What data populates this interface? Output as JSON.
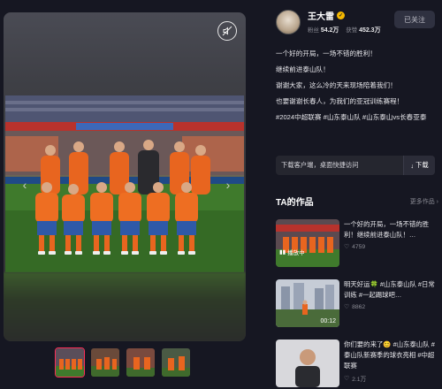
{
  "profile": {
    "name": "王大雷",
    "followers_label": "粉丝",
    "followers": "54.2万",
    "likes_label": "获赞",
    "likes": "452.3万",
    "follow_label": "已关注"
  },
  "post": {
    "lines": [
      "一个好的开局，一场不错的胜利！",
      "继续前进泰山队！",
      "谢谢大家，这么冷的天来现场陪着我们！",
      "也要谢谢长春人，为我们的亚冠训练赛程！",
      "#2024中超联赛 #山东泰山队 #山东泰山vs长春亚泰"
    ]
  },
  "download": {
    "text": "下载客户端，桌面快捷访问",
    "button": "下载"
  },
  "works": {
    "title": "TA的作品",
    "more": "更多作品",
    "items": [
      {
        "text": "一个好的开局，一场不错的胜利！继续前进泰山队！…",
        "likes": "4759",
        "badge": "播放中",
        "duration": ""
      },
      {
        "text": "明天好运🍀 #山东泰山队 #日常训练 #一起踢球吧…",
        "likes": "8862",
        "badge": "",
        "duration": "00:12"
      },
      {
        "text": "你们要的来了😊 #山东泰山队 #泰山队新赛季的球衣亮相 #中超联赛",
        "likes": "2.1万",
        "badge": "",
        "duration": ""
      }
    ]
  },
  "icons": {
    "mute": "muted-speaker-icon",
    "prev": "chevron-left-icon",
    "next": "chevron-right-icon",
    "heart": "heart-icon",
    "download": "download-icon",
    "verified": "verified-badge-icon"
  },
  "colors": {
    "background": "#161722",
    "accent": "#fe2c55",
    "jersey": "#e8651f",
    "verified": "#f5b800"
  }
}
